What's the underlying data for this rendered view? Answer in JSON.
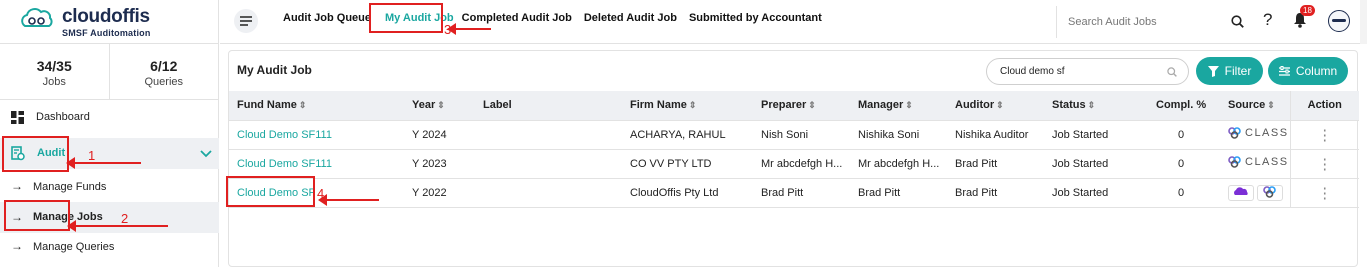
{
  "brand": {
    "name": "cloudoffis",
    "tagline": "SMSF Auditomation"
  },
  "stats": [
    {
      "value": "34/35",
      "label": "Jobs"
    },
    {
      "value": "6/12",
      "label": "Queries"
    }
  ],
  "sidebar": {
    "dashboard": "Dashboard",
    "audit": "Audit",
    "sub_items": [
      "Manage Funds",
      "Manage Jobs",
      "Manage Queries"
    ]
  },
  "top_tabs": [
    "Audit Job Queue",
    "My Audit Job",
    "Completed Audit Job",
    "Deleted Audit Job",
    "Submitted by Accountant"
  ],
  "top_search": {
    "placeholder": "Search Audit Jobs"
  },
  "notifications": {
    "count": "18"
  },
  "card": {
    "title": "My Audit Job",
    "search_value": "Cloud demo sf",
    "filter_label": "Filter",
    "column_label": "Column"
  },
  "table": {
    "headers": [
      "Fund Name",
      "Year",
      "Label",
      "Firm Name",
      "Preparer",
      "Manager",
      "Auditor",
      "Status",
      "Compl. %",
      "Source",
      "Action"
    ],
    "rows": [
      {
        "fund": "Cloud Demo SF111",
        "year": "Y 2024",
        "label": "",
        "firm": "ACHARYA, RAHUL",
        "preparer": "Nish Soni",
        "manager": "Nishika Soni",
        "auditor": "Nishika Auditor",
        "status": "Job Started",
        "compl": "0",
        "source": "CLASS"
      },
      {
        "fund": "Cloud Demo SF111",
        "year": "Y 2023",
        "label": "",
        "firm": "CO VV PTY LTD",
        "preparer": "Mr abcdefgh H...",
        "manager": "Mr abcdefgh H...",
        "auditor": "Brad Pitt",
        "status": "Job Started",
        "compl": "0",
        "source": "CLASS"
      },
      {
        "fund": "Cloud Demo SF",
        "year": "Y 2022",
        "label": "",
        "firm": "CloudOffis Pty Ltd",
        "preparer": "Brad Pitt",
        "manager": "Brad Pitt",
        "auditor": "Brad Pitt",
        "status": "Job Started",
        "compl": "0",
        "source": ""
      }
    ]
  },
  "annotations": [
    "1",
    "2",
    "3",
    "4"
  ],
  "colors": {
    "accent": "#1aa7a0",
    "annotation": "#e02020",
    "header_bg": "#eef0f3"
  }
}
